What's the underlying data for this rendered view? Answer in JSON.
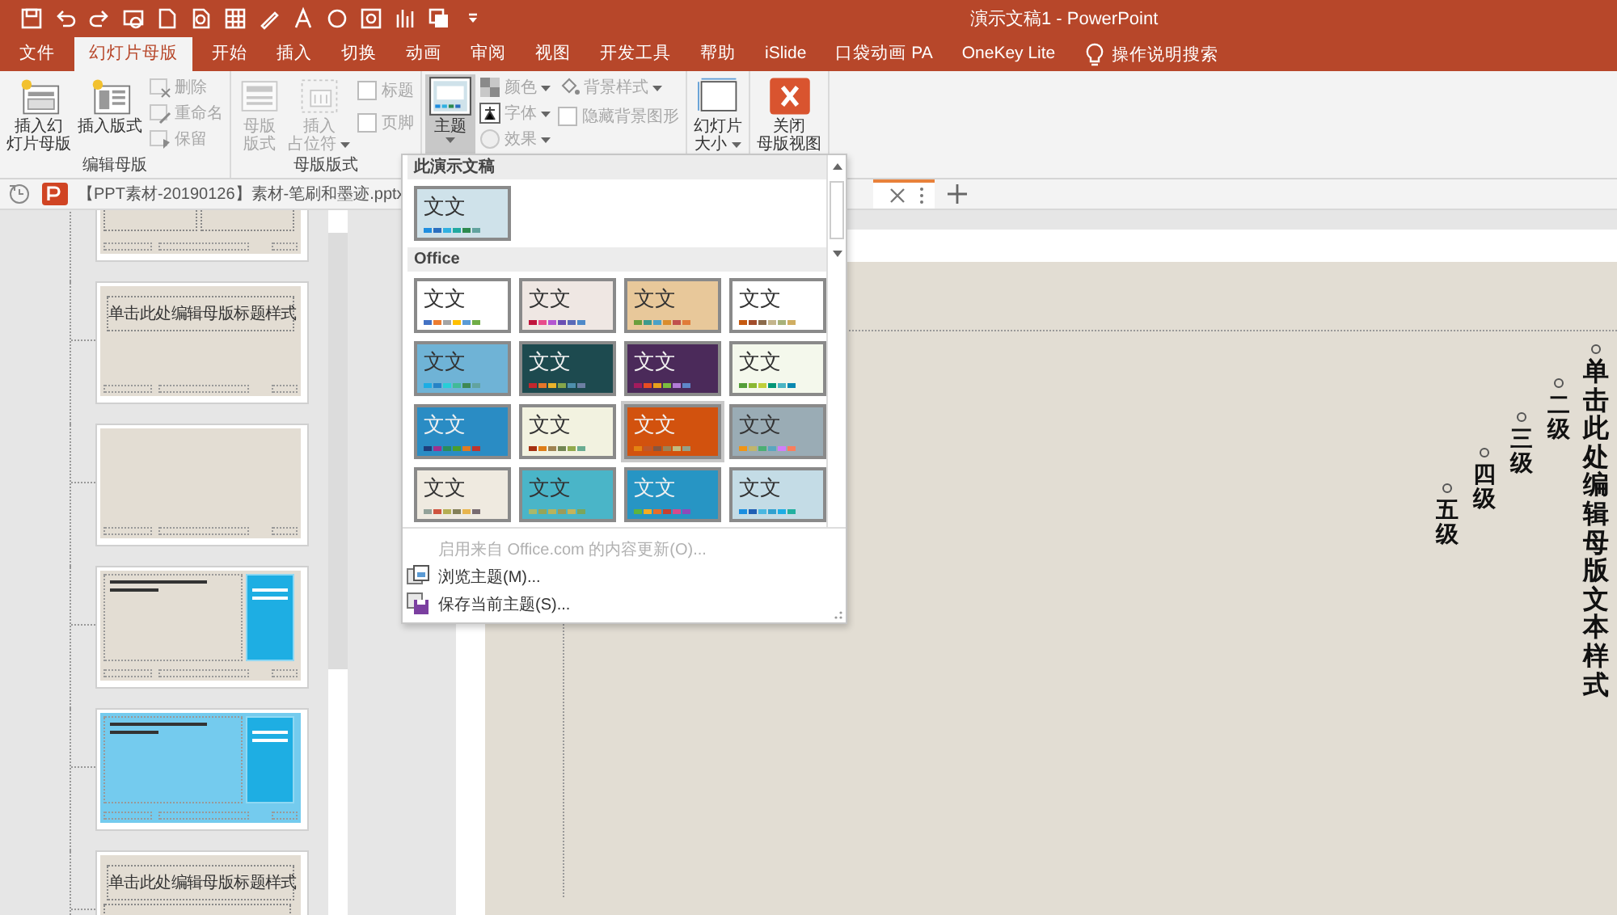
{
  "window": {
    "title": "演示文稿1  -  PowerPoint"
  },
  "ribbon_tabs": [
    {
      "label": "文件",
      "selected": false
    },
    {
      "label": "幻灯片母版",
      "selected": true
    },
    {
      "label": "开始",
      "selected": false
    },
    {
      "label": "插入",
      "selected": false
    },
    {
      "label": "切换",
      "selected": false
    },
    {
      "label": "动画",
      "selected": false
    },
    {
      "label": "审阅",
      "selected": false
    },
    {
      "label": "视图",
      "selected": false
    },
    {
      "label": "开发工具",
      "selected": false
    },
    {
      "label": "帮助",
      "selected": false
    },
    {
      "label": "iSlide",
      "selected": false
    },
    {
      "label": "口袋动画 PA",
      "selected": false
    },
    {
      "label": "OneKey Lite",
      "selected": false
    }
  ],
  "tell_me": {
    "placeholder": "操作说明搜索"
  },
  "ribbon_groups": [
    {
      "label": "编辑母版",
      "stacks": [
        [
          {
            "kind": "large",
            "lines": [
              "插入幻",
              "灯片母版"
            ],
            "disabled": false,
            "menu": false,
            "selected": false
          }
        ],
        [
          {
            "kind": "large",
            "lines": [
              "插入版式"
            ],
            "disabled": false,
            "menu": false,
            "selected": false
          }
        ],
        [
          {
            "kind": "small",
            "lines": [
              "删除"
            ],
            "disabled": true,
            "menu": false
          },
          {
            "kind": "small",
            "lines": [
              "重命名"
            ],
            "disabled": true,
            "menu": false
          },
          {
            "kind": "small",
            "lines": [
              "保留"
            ],
            "disabled": true,
            "menu": false
          }
        ]
      ]
    },
    {
      "label": "母版版式",
      "stacks": [
        [
          {
            "kind": "large",
            "lines": [
              "母版",
              "版式"
            ],
            "disabled": true,
            "menu": false,
            "selected": false
          }
        ],
        [
          {
            "kind": "large",
            "lines": [
              "插入",
              "占位符"
            ],
            "disabled": true,
            "menu": true,
            "selected": false
          }
        ],
        [
          {
            "kind": "check",
            "lines": [
              "标题"
            ],
            "disabled": true,
            "checked": false
          },
          {
            "kind": "check",
            "lines": [
              "页脚"
            ],
            "disabled": true,
            "checked": false
          }
        ]
      ]
    },
    {
      "stacks": [
        [
          {
            "kind": "large",
            "lines": [
              "主题"
            ],
            "disabled": false,
            "menu": true,
            "selected": true
          }
        ],
        [
          {
            "kind": "small",
            "lines": [
              "颜色"
            ],
            "disabled": true,
            "menu": true
          },
          {
            "kind": "small",
            "lines": [
              "字体"
            ],
            "disabled": true,
            "menu": true
          },
          {
            "kind": "small",
            "lines": [
              "效果"
            ],
            "disabled": true,
            "menu": true
          }
        ],
        [
          {
            "kind": "small",
            "lines": [
              "背景样式"
            ],
            "disabled": true,
            "menu": true
          },
          {
            "kind": "check",
            "lines": [
              "隐藏背景图形"
            ],
            "disabled": true,
            "checked": false
          }
        ]
      ]
    },
    {
      "stacks": [
        [
          {
            "kind": "large",
            "lines": [
              "幻灯片",
              "大小"
            ],
            "disabled": false,
            "menu": true,
            "selected": false
          }
        ]
      ]
    },
    {
      "stacks": [
        [
          {
            "kind": "large",
            "lines": [
              "关闭",
              "母版视图"
            ],
            "disabled": false,
            "menu": false,
            "selected": false
          }
        ]
      ]
    }
  ],
  "document_tab": {
    "label": "【PPT素材-20190126】素材-笔刷和墨迹.pptx"
  },
  "thumbnails": [
    {
      "kind": "two-content",
      "selected": false
    },
    {
      "kind": "title-only",
      "title": "单击此处编辑母版标题样式",
      "selected": false
    },
    {
      "kind": "blank",
      "selected": false
    },
    {
      "kind": "content-sidebar",
      "selected": false
    },
    {
      "kind": "picture-sidebar",
      "selected": false
    },
    {
      "kind": "title-vertical",
      "title": "单击此处编辑母版标题样式",
      "selected": false
    }
  ],
  "slide": {
    "levels": [
      {
        "text": "单击此处编辑母版文本样式"
      },
      {
        "text": "二级"
      },
      {
        "text": "三级"
      },
      {
        "text": "四级"
      },
      {
        "text": "五级"
      }
    ]
  },
  "theme_menu": {
    "sections": [
      {
        "title": "此演示文稿",
        "themes": [
          {
            "sample": "文文",
            "color": "#cfe2ea",
            "selected": false
          }
        ]
      },
      {
        "title": "Office",
        "themes": [
          {
            "sample": "文文",
            "color": "#ffffff",
            "selected": false
          },
          {
            "sample": "文文",
            "color": "#efe7e3",
            "selected": false
          },
          {
            "sample": "文文",
            "color": "#e8c89a",
            "selected": false
          },
          {
            "sample": "文文",
            "color": "#ffffff",
            "selected": false
          },
          {
            "sample": "文文",
            "color": "#6fb3d6",
            "selected": false
          },
          {
            "sample": "文文",
            "color": "#1d4a4f",
            "selected": false
          },
          {
            "sample": "文文",
            "color": "#4b2a5a",
            "selected": false
          },
          {
            "sample": "文文",
            "color": "#f4f8ec",
            "selected": false
          },
          {
            "sample": "文文",
            "color": "#2a8cc4",
            "selected": false
          },
          {
            "sample": "文文",
            "color": "#f2f2e0",
            "selected": false
          },
          {
            "sample": "文文",
            "color": "#d2520e",
            "selected": true
          },
          {
            "sample": "文文",
            "color": "#9aacb5",
            "selected": false
          },
          {
            "sample": "文文",
            "color": "#efeae0",
            "selected": false
          },
          {
            "sample": "文文",
            "color": "#4ab5c8",
            "selected": false
          },
          {
            "sample": "文文",
            "color": "#2795c4",
            "selected": false
          },
          {
            "sample": "文文",
            "color": "#c4dce6",
            "selected": false
          }
        ]
      }
    ],
    "actions": [
      {
        "kind": "update",
        "label": "启用来自 Office.com 的内容更新(O)...",
        "disabled": true
      },
      {
        "kind": "browse",
        "label": "浏览主题(M)...",
        "disabled": false
      },
      {
        "kind": "save",
        "label": "保存当前主题(S)...",
        "disabled": false
      }
    ]
  }
}
